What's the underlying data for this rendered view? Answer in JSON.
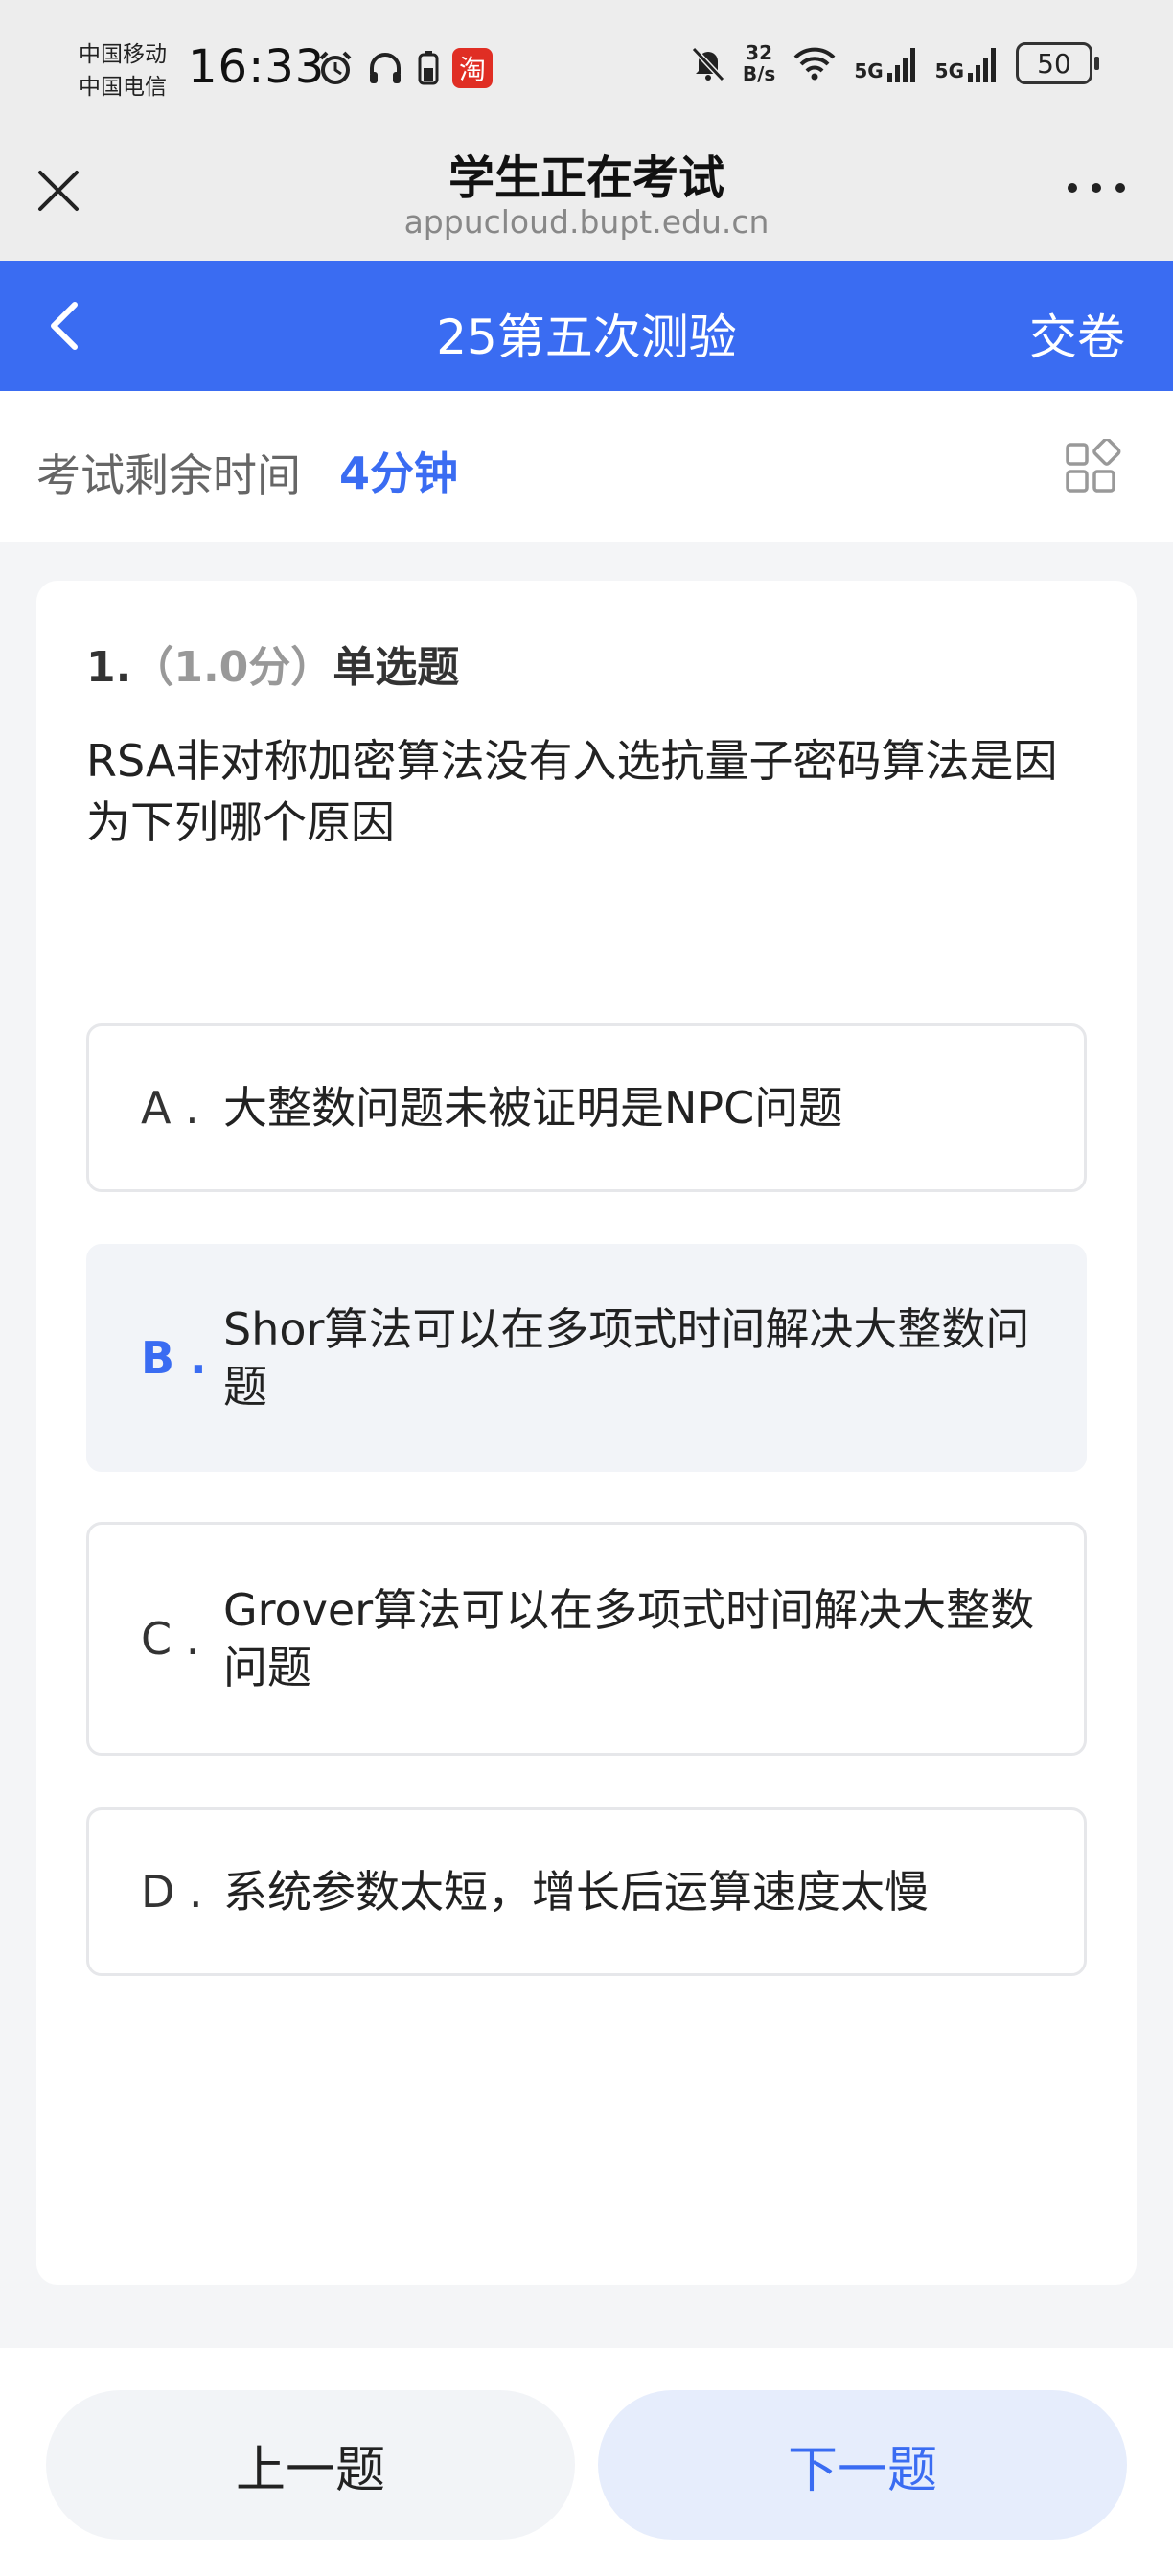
{
  "status_bar": {
    "carrier_1": "中国移动",
    "carrier_2": "中国电信",
    "time": "16:33",
    "network_speed_value": "32",
    "network_speed_unit": "B/s",
    "signal_1": "5G",
    "signal_2": "5G",
    "battery_level": "50",
    "app_badge": "淘",
    "icons": [
      "alarm-icon",
      "headphones-icon",
      "battery-small-icon",
      "taobao-icon",
      "mute-bell-icon",
      "wifi-icon",
      "signal-icon",
      "signal-icon"
    ]
  },
  "webview": {
    "title": "学生正在考试",
    "url": "appucloud.bupt.edu.cn"
  },
  "app_bar": {
    "title": "25第五次测验",
    "submit_label": "交卷"
  },
  "timer": {
    "label": "考试剩余时间",
    "value": "4分钟"
  },
  "question": {
    "number": "1.",
    "score": "（1.0分）",
    "type": "单选题",
    "text": "RSA非对称加密算法没有入选抗量子密码算法是因为下列哪个原因",
    "options": [
      {
        "letter": "A .",
        "text": "大整数问题未被证明是NPC问题",
        "selected": false
      },
      {
        "letter": "B .",
        "text": "Shor算法可以在多项式时间解决大整数问题",
        "selected": true
      },
      {
        "letter": "C .",
        "text": "Grover算法可以在多项式时间解决大整数问题",
        "selected": false
      },
      {
        "letter": "D .",
        "text": "系统参数太短，增长后运算速度太慢",
        "selected": false
      }
    ]
  },
  "bottom_nav": {
    "prev_label": "上一题",
    "next_label": "下一题"
  },
  "colors": {
    "accent": "#3a6cf2",
    "selected_bg": "#f2f4f8",
    "next_button_bg": "#e6edfc"
  }
}
